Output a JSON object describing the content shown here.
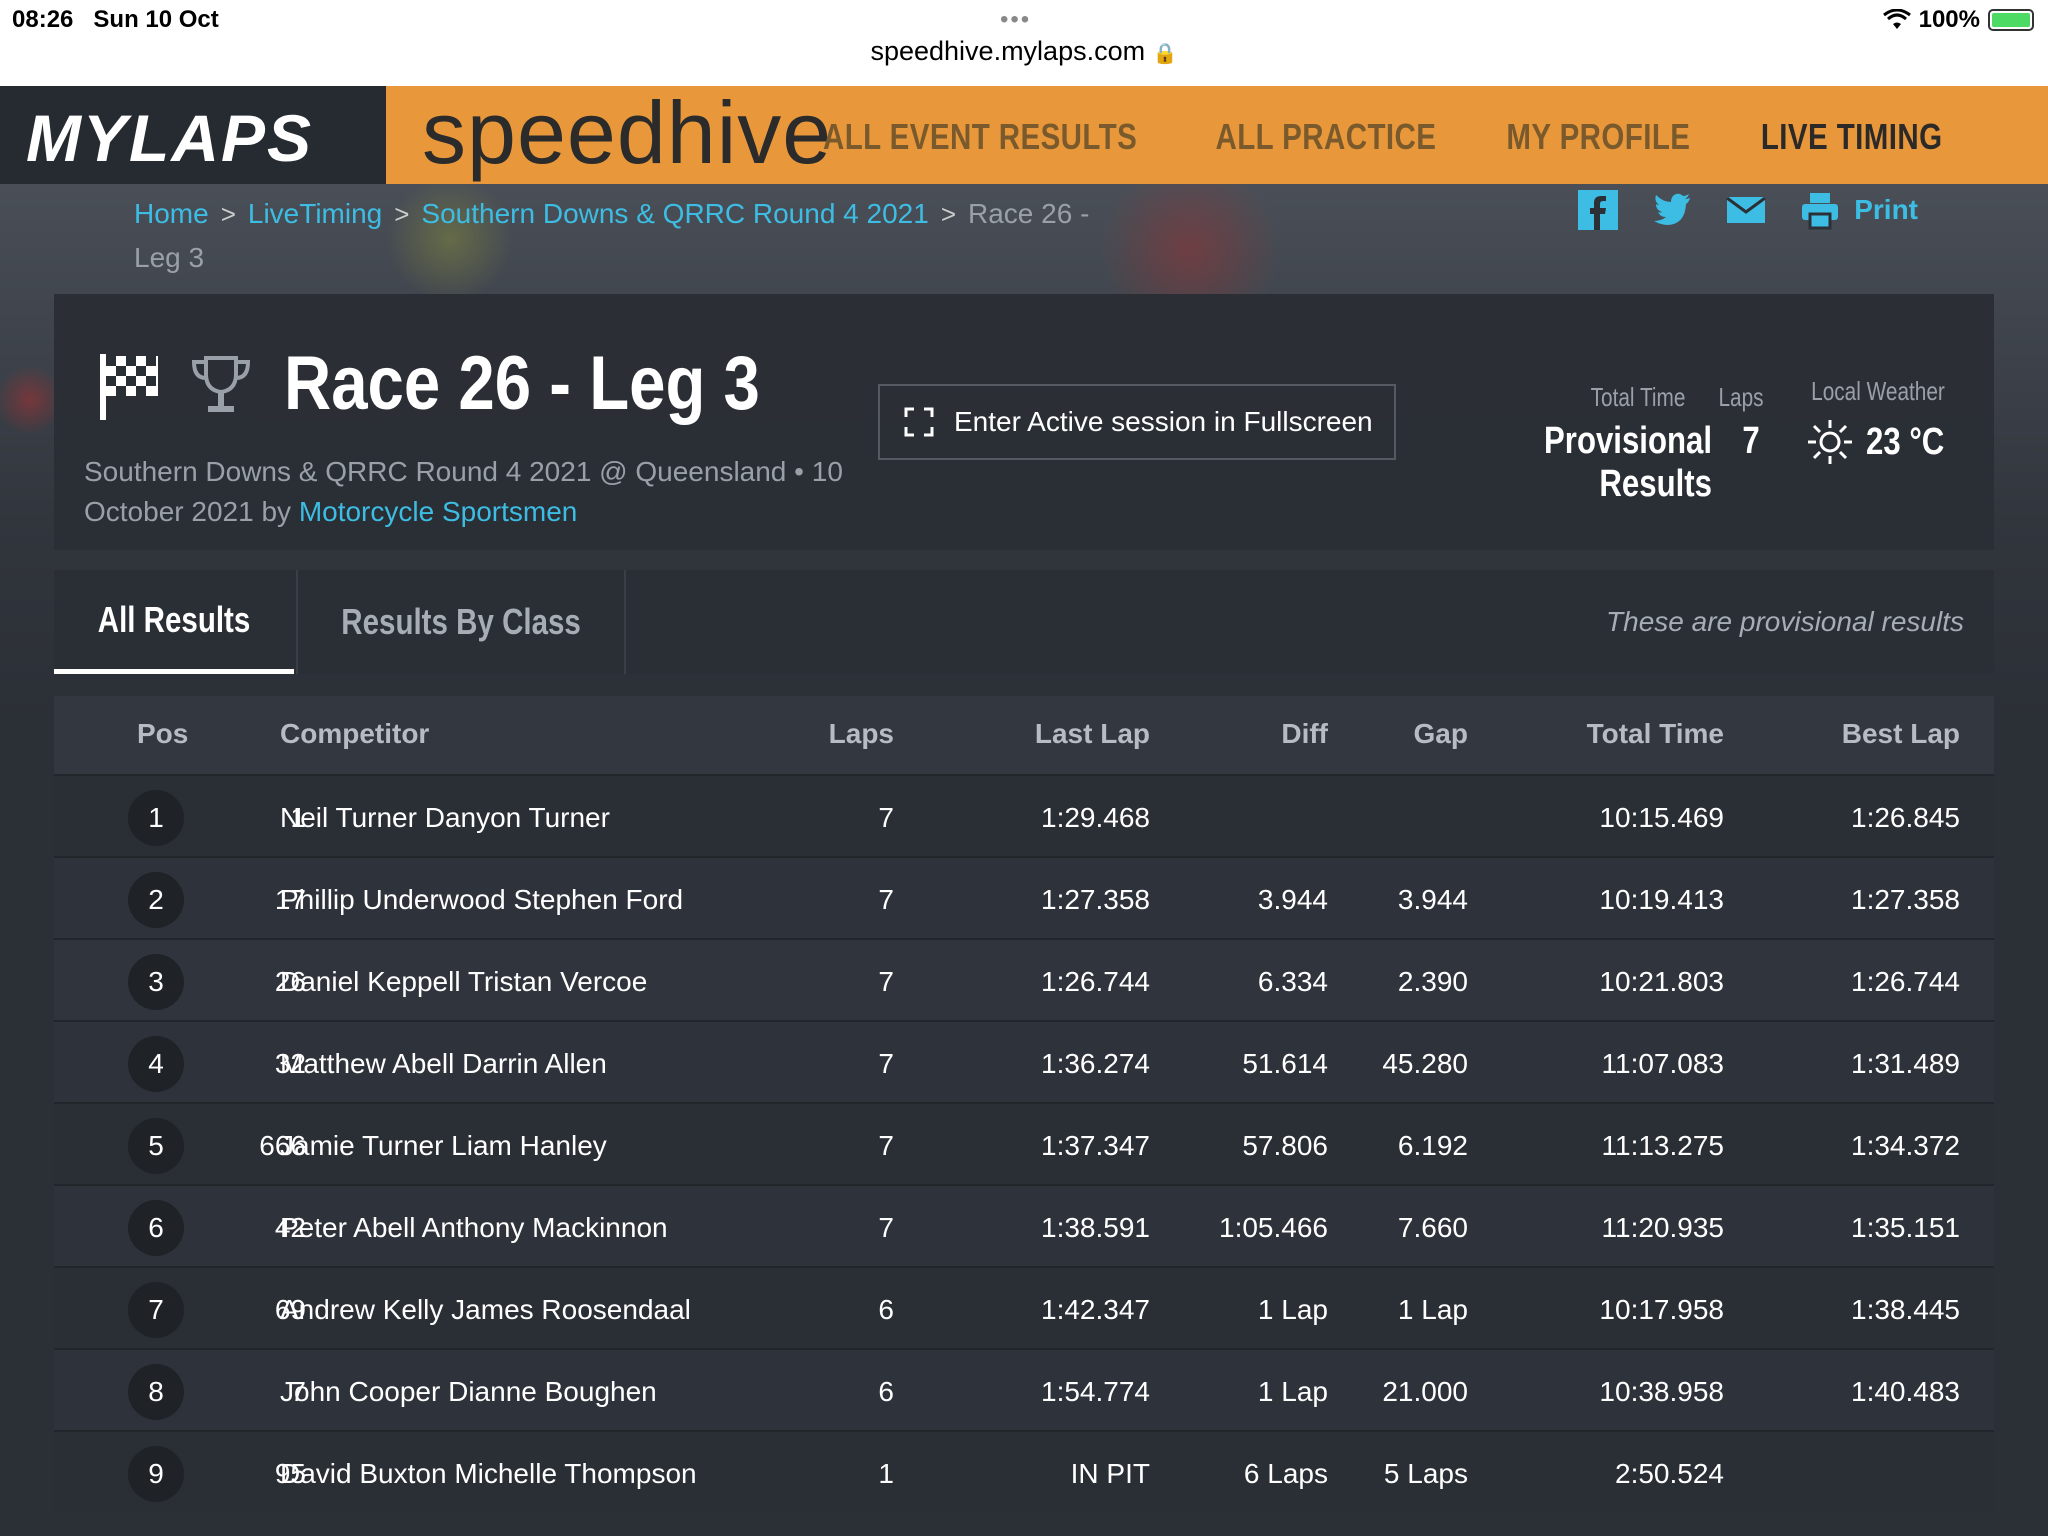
{
  "status_bar": {
    "time": "08:26",
    "date": "Sun 10 Oct",
    "dots": "•••",
    "url": "speedhive.mylaps.com",
    "battery": "100%"
  },
  "header": {
    "brand": "MYLAPS",
    "product": "speedhive",
    "nav": [
      "ALL EVENT RESULTS",
      "ALL PRACTICE",
      "MY PROFILE",
      "LIVE TIMING"
    ],
    "active_nav": "LIVE TIMING",
    "accent_color": "#e8983a"
  },
  "breadcrumb": {
    "items": [
      "Home",
      "LiveTiming",
      "Southern Downs & QRRC Round 4 2021"
    ],
    "current": "Race 26 - Leg 3"
  },
  "share": {
    "icons": [
      "facebook-icon",
      "twitter-icon",
      "email-icon",
      "print-icon"
    ],
    "print_label": "Print"
  },
  "session": {
    "title": "Race 26 - Leg 3",
    "subtitle_prefix": "Southern Downs & QRRC Round 4 2021 @ Queensland • 10 October 2021 by ",
    "organizer": "Motorcycle Sportsmen",
    "fullscreen_label": "Enter Active session in Fullscreen",
    "total_time_label": "Total Time",
    "total_time_value": "Provisional Results",
    "laps_label": "Laps",
    "laps_value": "7",
    "weather_label": "Local Weather",
    "weather_value": "23 °C"
  },
  "tabs": {
    "items": [
      "All Results",
      "Results By Class"
    ],
    "active": "All Results",
    "note": "These are provisional results"
  },
  "table": {
    "headers": {
      "pos": "Pos",
      "competitor": "Competitor",
      "laps": "Laps",
      "last_lap": "Last Lap",
      "diff": "Diff",
      "gap": "Gap",
      "total_time": "Total Time",
      "best_lap": "Best Lap"
    },
    "rows": [
      {
        "pos": "1",
        "num": "1",
        "name": "Neil Turner Danyon Turner",
        "laps": "7",
        "last": "1:29.468",
        "diff": "",
        "gap": "",
        "total": "10:15.469",
        "best": "1:26.845"
      },
      {
        "pos": "2",
        "num": "17",
        "name": "Phillip Underwood Stephen Ford",
        "laps": "7",
        "last": "1:27.358",
        "diff": "3.944",
        "gap": "3.944",
        "total": "10:19.413",
        "best": "1:27.358"
      },
      {
        "pos": "3",
        "num": "26",
        "name": "Daniel Keppell Tristan Vercoe",
        "laps": "7",
        "last": "1:26.744",
        "diff": "6.334",
        "gap": "2.390",
        "total": "10:21.803",
        "best": "1:26.744"
      },
      {
        "pos": "4",
        "num": "32",
        "name": "Matthew Abell Darrin Allen",
        "laps": "7",
        "last": "1:36.274",
        "diff": "51.614",
        "gap": "45.280",
        "total": "11:07.083",
        "best": "1:31.489"
      },
      {
        "pos": "5",
        "num": "666",
        "name": "Jamie Turner Liam Hanley",
        "laps": "7",
        "last": "1:37.347",
        "diff": "57.806",
        "gap": "6.192",
        "total": "11:13.275",
        "best": "1:34.372"
      },
      {
        "pos": "6",
        "num": "42",
        "name": "Peter Abell Anthony Mackinnon",
        "laps": "7",
        "last": "1:38.591",
        "diff": "1:05.466",
        "gap": "7.660",
        "total": "11:20.935",
        "best": "1:35.151"
      },
      {
        "pos": "7",
        "num": "69",
        "name": "Andrew Kelly James Roosendaal",
        "laps": "6",
        "last": "1:42.347",
        "diff": "1 Lap",
        "gap": "1 Lap",
        "total": "10:17.958",
        "best": "1:38.445"
      },
      {
        "pos": "8",
        "num": "7",
        "name": "John Cooper Dianne Boughen",
        "laps": "6",
        "last": "1:54.774",
        "diff": "1 Lap",
        "gap": "21.000",
        "total": "10:38.958",
        "best": "1:40.483"
      },
      {
        "pos": "9",
        "num": "95",
        "name": "David Buxton Michelle Thompson",
        "laps": "1",
        "last": "IN PIT",
        "diff": "6 Laps",
        "gap": "5 Laps",
        "total": "2:50.524",
        "best": ""
      }
    ]
  }
}
